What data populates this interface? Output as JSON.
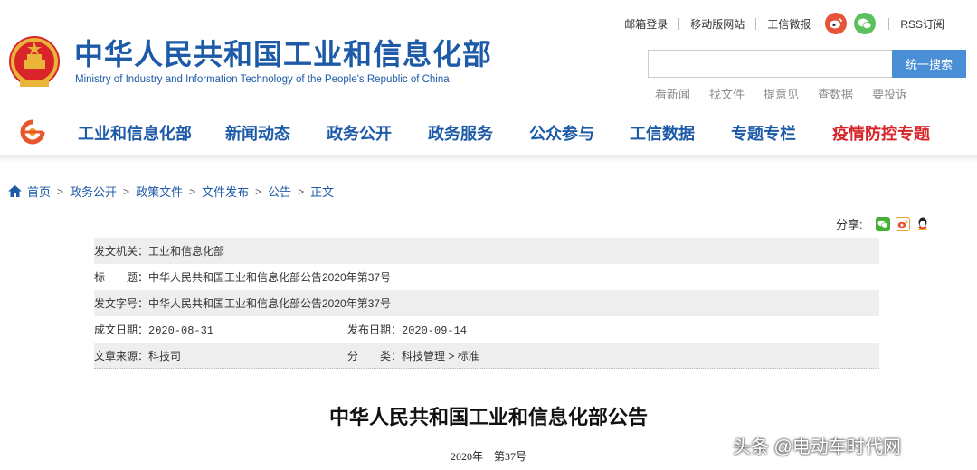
{
  "header": {
    "title": "中华人民共和国工业和信息化部",
    "subtitle": "Ministry of Industry and Information Technology of the People's Republic of China",
    "top_links": [
      "邮箱登录",
      "移动版网站",
      "工信微报"
    ],
    "rss_label": "RSS订阅",
    "search": {
      "placeholder": "",
      "button_label": "统一搜索"
    },
    "quick_links": [
      "看新闻",
      "找文件",
      "提意见",
      "查数据",
      "要投诉"
    ]
  },
  "nav": {
    "items": [
      "工业和信息化部",
      "新闻动态",
      "政务公开",
      "政务服务",
      "公众参与",
      "工信数据",
      "专题专栏",
      "疫情防控专题"
    ]
  },
  "breadcrumb": {
    "items": [
      "首页",
      "政务公开",
      "政策文件",
      "文件发布",
      "公告",
      "正文"
    ],
    "separator": ">"
  },
  "share": {
    "label": "分享:"
  },
  "meta": {
    "issuer": "发文机关：工业和信息化部",
    "title": "标　　题：中华人民共和国工业和信息化部公告2020年第37号",
    "doc_number": "发文字号：中华人民共和国工业和信息化部公告2020年第37号",
    "created_date": "成文日期：2020-08-31",
    "publish_date": "发布日期：2020-09-14",
    "source": "文章来源：科技司",
    "category": "分　　类：科技管理 > 标准"
  },
  "article": {
    "title": "中华人民共和国工业和信息化部公告",
    "number": "2020年　第37号"
  },
  "watermark": "头条 @电动车时代网",
  "colors": {
    "brand_blue": "#1d5aa8",
    "alert_red": "#d9252a",
    "search_button": "#4a8fd6",
    "row_shade": "#eeeeee"
  }
}
